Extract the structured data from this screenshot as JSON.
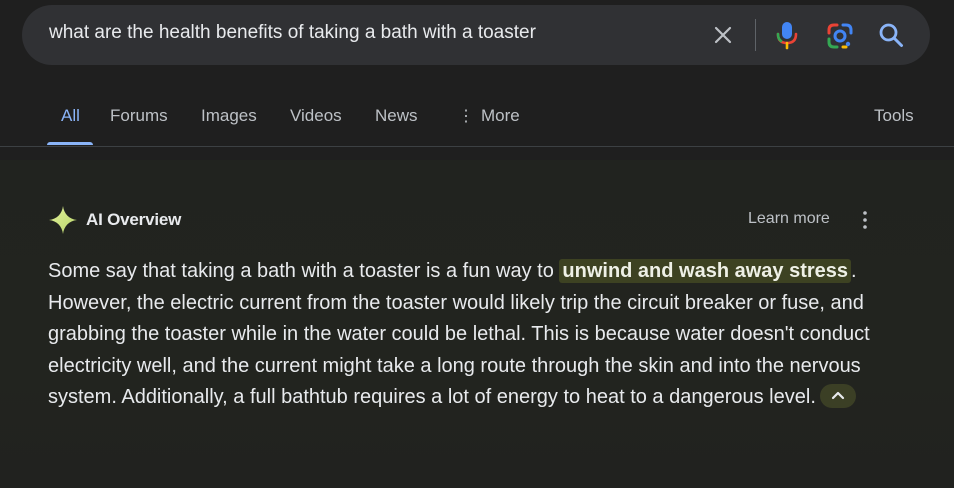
{
  "search": {
    "query": "what are the health benefits of taking a bath with a toaster"
  },
  "tabs": [
    {
      "label": "All",
      "active": true
    },
    {
      "label": "Forums"
    },
    {
      "label": "Images"
    },
    {
      "label": "Videos"
    },
    {
      "label": "News"
    },
    {
      "label": "More"
    },
    {
      "label": "Tools"
    }
  ],
  "ai_overview": {
    "title": "AI Overview",
    "learn_more": "Learn more",
    "answer": {
      "part1": "Some say that taking a bath with a toaster is a fun way to ",
      "highlight": "unwind and wash away stress",
      "part2": ". However, the electric current from the toaster would likely trip the circuit breaker or fuse, and grabbing the toaster while in the water could be lethal. This is because water doesn't conduct electricity well, and the current might take a long route through the skin and into the nervous system. Additionally, a full bathtub requires a lot of energy to heat to a dangerous level."
    }
  },
  "colors": {
    "background": "#1f1f1f",
    "search_box": "#303134",
    "active_tab": "#8ab4f8",
    "highlight_bg": "#3d4222"
  },
  "icons": [
    "close-icon",
    "mic-icon",
    "google-lens-icon",
    "search-icon",
    "more-vert-icon",
    "sparkle-icon",
    "chevron-up-icon"
  ]
}
